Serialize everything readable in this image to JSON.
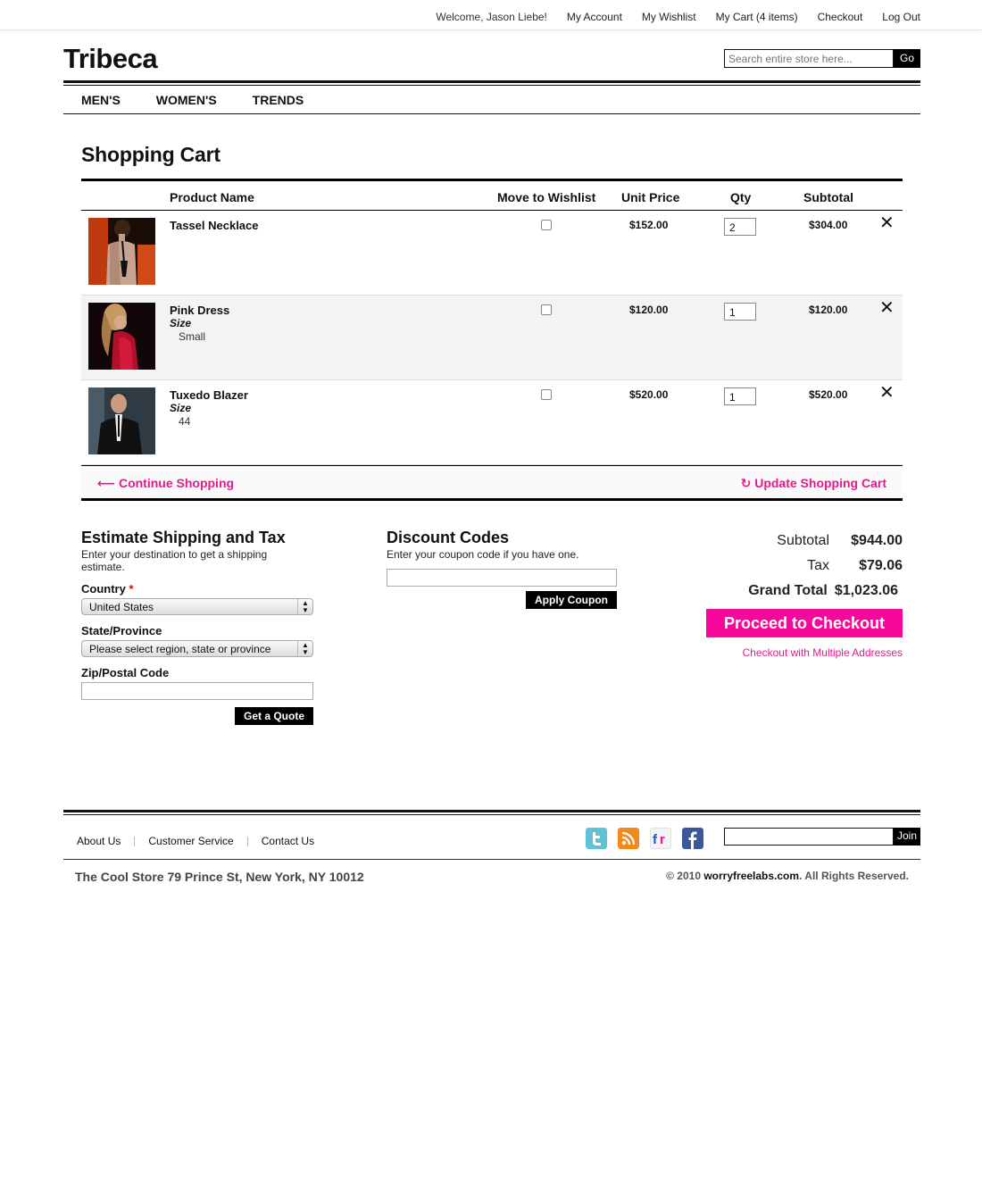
{
  "topbar": {
    "welcome": "Welcome, Jason Liebe!",
    "my_account": "My Account",
    "my_wishlist": "My Wishlist",
    "my_cart": "My Cart (4 items)",
    "checkout": "Checkout",
    "logout": "Log Out"
  },
  "header": {
    "logo": "Tribeca",
    "search_placeholder": "Search entire store here...",
    "search_button": "Go"
  },
  "nav": [
    "MEN'S",
    "WOMEN'S",
    "TRENDS"
  ],
  "cart": {
    "title": "Shopping Cart",
    "columns": {
      "product_name": "Product Name",
      "move_to_wishlist": "Move to Wishlist",
      "unit_price": "Unit Price",
      "qty": "Qty",
      "subtotal": "Subtotal"
    },
    "items": [
      {
        "name": "Tassel Necklace",
        "option_label": "",
        "option_value": "",
        "unit_price": "$152.00",
        "qty": "2",
        "subtotal": "$304.00"
      },
      {
        "name": "Pink Dress",
        "option_label": "Size",
        "option_value": "Small",
        "unit_price": "$120.00",
        "qty": "1",
        "subtotal": "$120.00"
      },
      {
        "name": "Tuxedo Blazer",
        "option_label": "Size",
        "option_value": "44",
        "unit_price": "$520.00",
        "qty": "1",
        "subtotal": "$520.00"
      }
    ],
    "continue_label": "Continue Shopping",
    "update_label": "Update Shopping Cart"
  },
  "shipping": {
    "title": "Estimate Shipping and Tax",
    "desc": "Enter your destination to get a shipping estimate.",
    "country_label": "Country",
    "required_mark": "*",
    "country_value": "United States",
    "state_label": "State/Province",
    "state_value": "Please select region, state or province",
    "zip_label": "Zip/Postal Code",
    "quote_button": "Get a Quote"
  },
  "discount": {
    "title": "Discount Codes",
    "desc": "Enter your coupon code if you have one.",
    "apply_button": "Apply Coupon"
  },
  "totals": {
    "subtotal_label": "Subtotal",
    "subtotal_value": "$944.00",
    "tax_label": "Tax",
    "tax_value": "$79.06",
    "grand_label": "Grand Total",
    "grand_value": "$1,023.06",
    "checkout_button": "Proceed to Checkout",
    "multi_link": "Checkout with Multiple Addresses"
  },
  "footer": {
    "links": [
      "About Us",
      "Customer Service",
      "Contact Us"
    ],
    "join_button": "Join",
    "address": "The Cool Store 79 Prince St, New York, NY 10012",
    "copy_pre": "© 2010 ",
    "copy_domain": "worryfreelabs.com",
    "copy_post": ". All Rights Reserved.",
    "social": [
      "twitter-icon",
      "rss-icon",
      "flickr-icon",
      "facebook-icon"
    ]
  },
  "colors": {
    "accent": "#f7089b",
    "link_pink": "#e8188a",
    "black": "#000000"
  }
}
